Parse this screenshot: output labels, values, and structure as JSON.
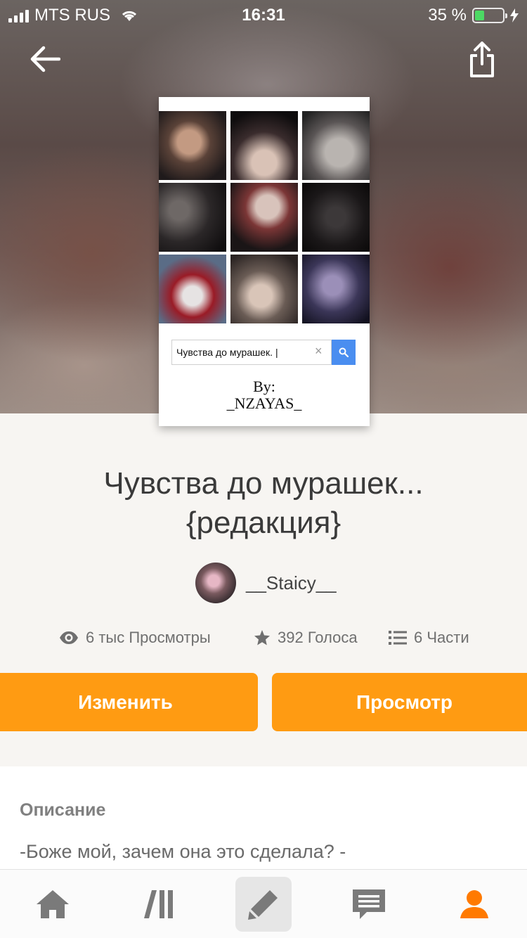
{
  "status_bar": {
    "carrier": "MTS RUS",
    "time": "16:31",
    "battery": "35 %",
    "battery_level": 0.35
  },
  "cover": {
    "search_text": "Чувства до мурашек. |",
    "by_label": "By:",
    "author_tag": "_NZAYAS_"
  },
  "story": {
    "title_line1": "Чувства до мурашек...",
    "title_line2": "{редакция}",
    "author": "__Staicy__"
  },
  "stats": {
    "views": "6 тыс Просмотры",
    "votes": "392 Голоса",
    "parts": "6 Части"
  },
  "actions": {
    "edit_label": "Изменить",
    "view_label": "Просмотр"
  },
  "description": {
    "heading": "Описание",
    "text": "-Боже мой, зачем она это сделала? -"
  },
  "tabbar": {
    "items": [
      "home-icon",
      "library-icon",
      "write-icon",
      "messages-icon",
      "profile-icon"
    ],
    "active": "write-icon"
  },
  "colors": {
    "accent": "#ff9b12",
    "profile_active": "#ff7a00",
    "search_button": "#4a8ef0",
    "battery_fill": "#4cd964"
  }
}
